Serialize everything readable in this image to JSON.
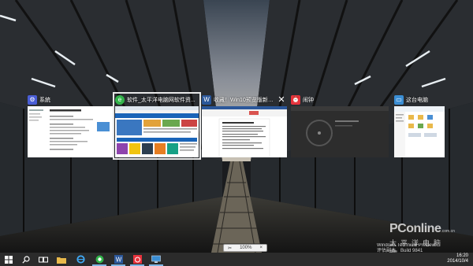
{
  "task_view": {
    "windows": [
      {
        "id": "w1",
        "title": "系統",
        "icon": "system-icon",
        "icon_color": "#4a5ed6"
      },
      {
        "id": "w2",
        "title": "软件_太平洋电脑网软件资...",
        "icon": "browser-360-icon",
        "icon_color": "#32b34a"
      },
      {
        "id": "w3",
        "title": "收藏！Win10预览版新快捷键...",
        "icon": "word-icon",
        "icon_color": "#2b579a"
      },
      {
        "id": "w4",
        "title": "闹钟",
        "icon": "alarm-icon",
        "icon_color": "#e8323c"
      },
      {
        "id": "w5",
        "title": "这台电脑",
        "icon": "this-pc-icon",
        "icon_color": "#3b8ed4"
      }
    ],
    "close_glyph": "✕"
  },
  "taskbar": {
    "items": [
      {
        "name": "start-icon"
      },
      {
        "name": "search-icon"
      },
      {
        "name": "task-view-icon"
      },
      {
        "name": "file-explorer-icon"
      },
      {
        "name": "internet-explorer-icon"
      },
      {
        "name": "browser-360-icon"
      },
      {
        "name": "word-icon"
      },
      {
        "name": "alarm-icon"
      },
      {
        "name": "this-pc-icon"
      }
    ]
  },
  "watermark": {
    "brand": "PConline",
    "domain": ".com.cn",
    "cn": "太平洋电脑网"
  },
  "os_build": {
    "line1": "Windows Technical Preview",
    "line2": "评估副本。Build 9841"
  },
  "clock": {
    "time": "16:20",
    "date": "2014/10/4"
  },
  "floating_toolbar": {
    "zoom": "100%"
  }
}
